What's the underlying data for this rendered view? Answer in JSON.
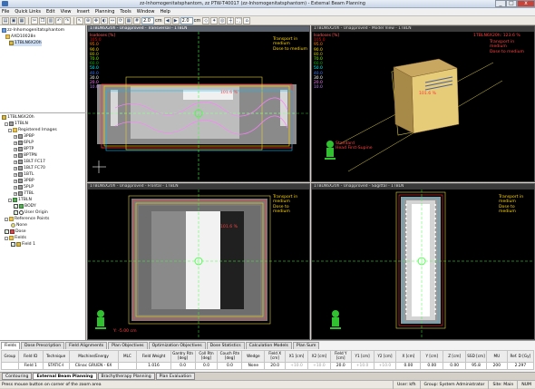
{
  "window": {
    "title": "zz-Inhomogenitatsphantom, zz PTW-T40017 (zz-Inhomogenitatsphantom) - External Beam Planning",
    "min": "_",
    "max": "□",
    "close": "x"
  },
  "menu": [
    "File",
    "Quick Links",
    "Edit",
    "View",
    "Insert",
    "Planning",
    "Tools",
    "Window",
    "Help"
  ],
  "toolbar": {
    "zoom_value": "2.0",
    "zoom_unit": "cm",
    "step_value": "2.0",
    "step_unit": "cm"
  },
  "tree_top": [
    {
      "label": "zz-Inhomogenitatsphantom",
      "icon": "patient"
    },
    {
      "label": "AXD10028n",
      "icon": "folder"
    },
    {
      "label": "1TBLN6X20h",
      "icon": "plan",
      "selected": true
    }
  ],
  "tree_main": [
    {
      "label": "1TBLN6X20h",
      "icon": "plan"
    },
    {
      "label": "1TBLN",
      "icon": "plan"
    },
    {
      "label": "Registered Images",
      "icon": "folder"
    },
    {
      "label": "3PBP",
      "icon": "image"
    },
    {
      "label": "6PLP",
      "icon": "image"
    },
    {
      "label": "8PTP",
      "icon": "image"
    },
    {
      "label": "8PTPN",
      "icon": "image"
    },
    {
      "label": "1BLT FC17",
      "icon": "image"
    },
    {
      "label": "1BLT FC70",
      "icon": "image"
    },
    {
      "label": "1BTL",
      "icon": "image"
    },
    {
      "label": "3PBP",
      "icon": "image"
    },
    {
      "label": "5PLP",
      "icon": "image"
    },
    {
      "label": "7TBL",
      "icon": "image"
    },
    {
      "label": "1TBLN",
      "icon": "structure"
    },
    {
      "label": "BODY",
      "icon": "check"
    },
    {
      "label": "User Origin",
      "icon": "origin"
    },
    {
      "label": "Reference Points",
      "icon": "folder"
    },
    {
      "label": "None",
      "icon": "none"
    },
    {
      "label": "Dose",
      "icon": "dose"
    },
    {
      "label": "Fields",
      "icon": "folder"
    },
    {
      "label": "Field 1",
      "icon": "field"
    }
  ],
  "views": {
    "transversal": {
      "title": "1TBLN6X20h - Unapproved - Transversal - 1TBLN",
      "note": [
        "Transport in",
        "medium",
        "Dose to medium"
      ],
      "dose_title": "Isodoses [%]",
      "isodoses": [
        "105.0",
        "95.0",
        "90.0",
        "80.0",
        "70.0",
        "60.0",
        "50.0",
        "40.0",
        "30.0",
        "20.0",
        "10.0"
      ],
      "dose_label": "101.6 %"
    },
    "model": {
      "title": "1TBLN6X20h - Unapproved - Model View - 1TBLN",
      "dose_title": "Isodoses [%]",
      "isodoses": [
        "105.0",
        "95.0",
        "90.0",
        "80.0",
        "70.0",
        "60.0",
        "50.0",
        "40.0",
        "30.0",
        "20.0",
        "10.0"
      ],
      "note": [
        "Transport in",
        "medium",
        "Dose to medium"
      ],
      "top_label": "1TBLN6X20h: 123.6 %",
      "dose_label": "101.6 %",
      "orient": [
        "Standard",
        "Head First-Supine"
      ]
    },
    "frontal": {
      "title": "1TBLN6X20h - Unapproved - Frontal - 1TBLN",
      "note": [
        "Transport in",
        "medium",
        "Dose to",
        "medium"
      ],
      "dose_label": "101.6 %",
      "scale": "Y: -5.00 cm"
    },
    "sagittal": {
      "title": "1TBLN6X20h - Unapproved - Sagittal - 1TBLN",
      "note": [
        "Transport in",
        "medium",
        "Dose to",
        "medium"
      ]
    }
  },
  "bottom_tabs": [
    "Fields",
    "Dose Prescription",
    "Field Alignments",
    "Plan Objectives",
    "Optimization Objectives",
    "Dose Statistics",
    "Calculation Models",
    "Plan Sum"
  ],
  "table": {
    "headers": [
      "Group",
      "Field ID",
      "Technique",
      "Machine/Energy",
      "MLC",
      "Field Weight",
      "Gantry Rtn [deg]",
      "Coll Rtn [deg]",
      "Couch Rtn [deg]",
      "Wedge",
      "Field X [cm]",
      "X1 [cm]",
      "X2 [cm]",
      "Field Y [cm]",
      "Y1 [cm]",
      "Y2 [cm]",
      "X [cm]",
      "Y [cm]",
      "Z [cm]",
      "SSD [cm]",
      "MU",
      "Ref. D [Gy]"
    ],
    "rows": [
      [
        "",
        "Field 1",
        "STATIC-I",
        "Clinac GRUEN - 6X",
        "",
        "1.016",
        "0.0",
        "0.0",
        "0.0",
        "None",
        "20.0",
        "+10.0",
        "+10.0",
        "20.0",
        "+10.0",
        "+10.0",
        "0.00",
        "0.00",
        "0.00",
        "95.8",
        "200",
        "2.297"
      ]
    ]
  },
  "workspace_tabs": [
    "Contouring",
    "External Beam Planning",
    "Brachytherapy Planning",
    "Plan Evaluation"
  ],
  "status": {
    "message": "Press mouse button on corner of the zoom area",
    "user": "User: kfh",
    "group": "Group: System Administrator",
    "site": "Site: Main",
    "num": "NUM"
  },
  "colors": {
    "isodose": [
      "#ff0000",
      "#ff7f00",
      "#ffd700",
      "#c8c800",
      "#7fff00",
      "#00c000",
      "#00ffff",
      "#4080ff",
      "#ffffff",
      "#ff80ff",
      "#c080ff"
    ],
    "note": "#ffd600",
    "field": "#e0d040"
  }
}
